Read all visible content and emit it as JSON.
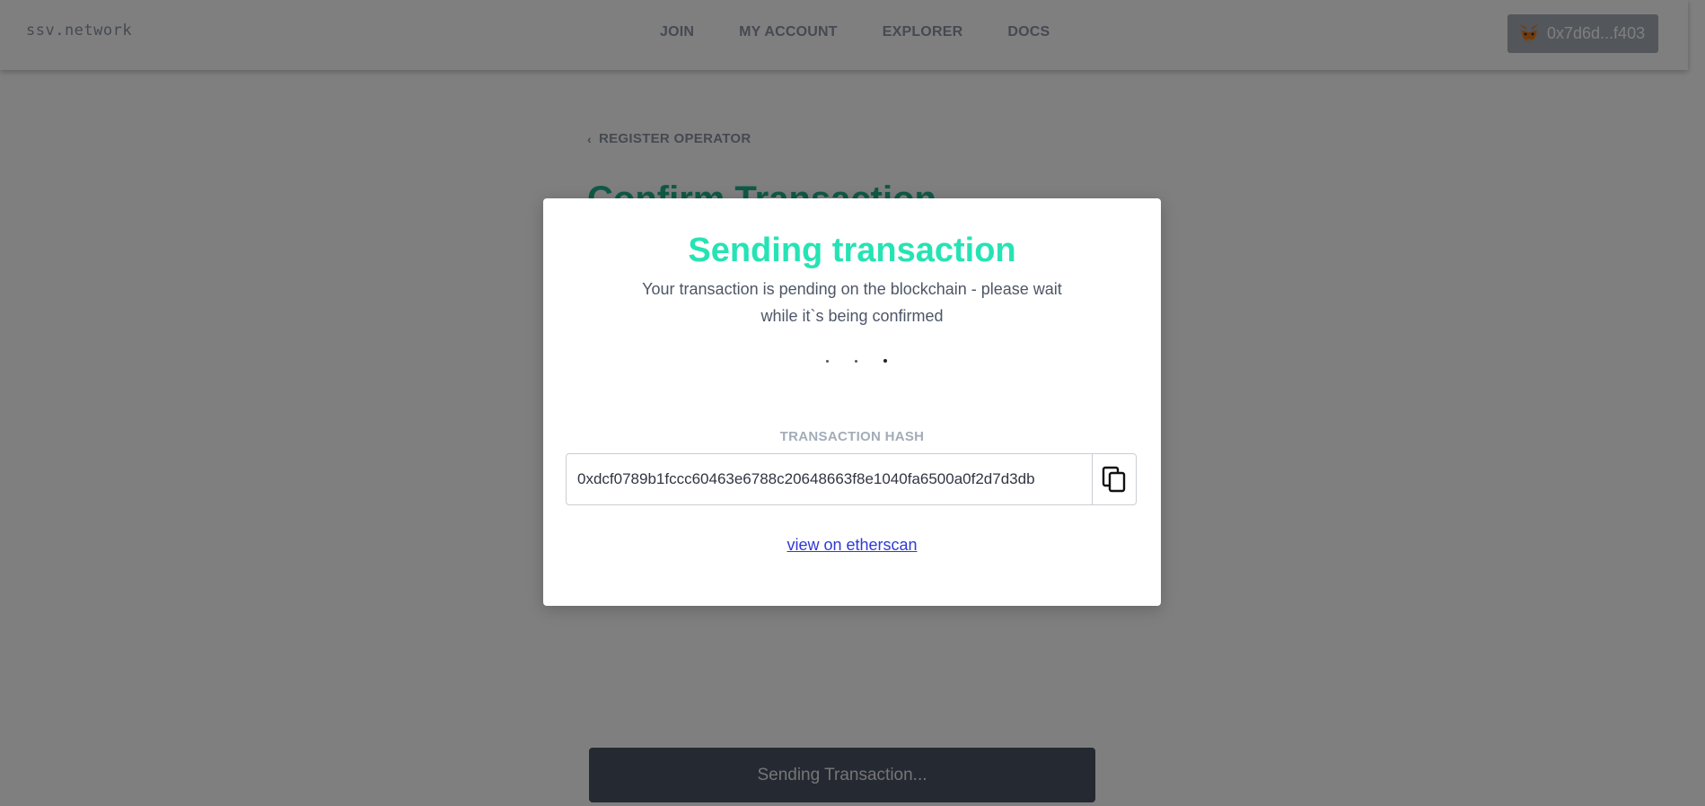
{
  "header": {
    "brand": "ssv.network",
    "nav": [
      "JOIN",
      "MY ACCOUNT",
      "EXPLORER",
      "DOCS"
    ],
    "wallet_address": "0x7d6d...f403",
    "wallet_icon": "metamask-fox-icon"
  },
  "page": {
    "back_label": "REGISTER OPERATOR",
    "title": "Confirm Transaction",
    "bottom_button": "Sending Transaction..."
  },
  "modal": {
    "title": "Sending transaction",
    "description_line1": "Your transaction is pending on the blockchain - please wait",
    "description_line2": "while it`s being confirmed",
    "hash_label": "TRANSACTION HASH",
    "hash_value": "0xdcf0789b1fccc60463e6788c20648663f8e1040fa6500a0f2d7d3db",
    "copy_icon": "copy-icon",
    "etherscan_link": "view on etherscan"
  },
  "colors": {
    "accent": "#26e3b4",
    "link": "#2f3ad6",
    "overlay": "rgba(0,0,0,0.5)"
  }
}
